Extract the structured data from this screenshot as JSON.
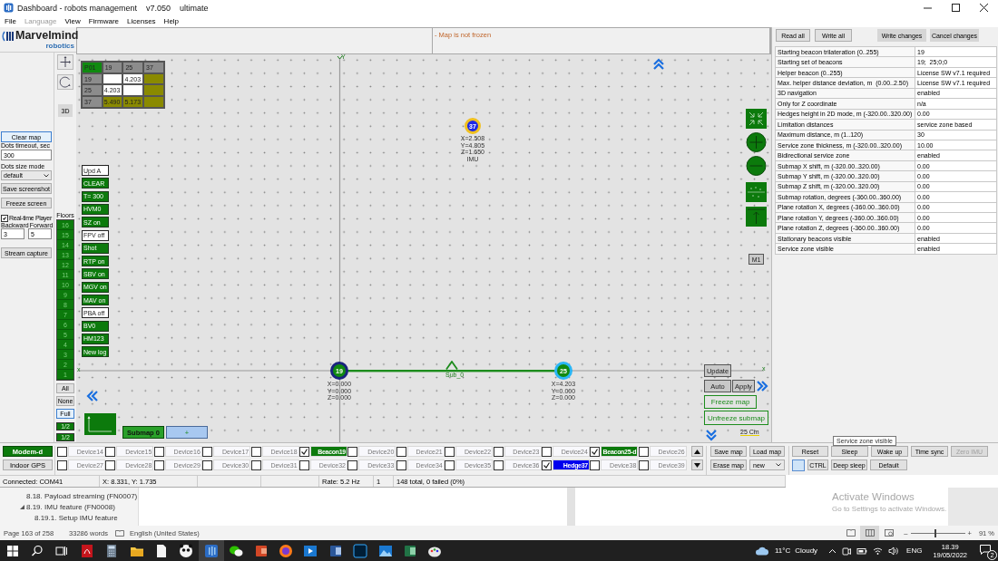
{
  "window": {
    "title": "Dashboard - robots management",
    "version": "v7.050",
    "edition": "ultimate"
  },
  "menu": [
    {
      "label": "File",
      "disabled": false
    },
    {
      "label": "Language",
      "disabled": true
    },
    {
      "label": "View",
      "disabled": false
    },
    {
      "label": "Firmware",
      "disabled": false
    },
    {
      "label": "Licenses",
      "disabled": false
    },
    {
      "label": "Help",
      "disabled": false
    }
  ],
  "logo": {
    "name": "Marvelmind",
    "tagline": "robotics"
  },
  "left_panel": {
    "clear_map": "Clear map",
    "dots_timeout": {
      "label": "Dots timeout, sec",
      "value": "300"
    },
    "dots_size": {
      "label": "Dots size mode",
      "value": "default"
    },
    "save_screenshot": "Save screenshot",
    "freeze_screen": "Freeze screen",
    "realtime_player": {
      "label": "Real-time Player",
      "checked": true
    },
    "backward": {
      "label": "Backward",
      "value": "3"
    },
    "forward": {
      "label": "Forward",
      "value": "5"
    },
    "stream_capture": "Stream capture"
  },
  "tools": {
    "view_3d": "3D"
  },
  "floors": {
    "label": "Floors",
    "items": [
      "16",
      "15",
      "14",
      "13",
      "12",
      "11",
      "10",
      "9",
      "8",
      "7",
      "6",
      "5",
      "4",
      "3",
      "2",
      "1"
    ],
    "filters": [
      {
        "label": "All",
        "selected": false
      },
      {
        "label": "None",
        "selected": false
      },
      {
        "label": "Full",
        "selected": true
      }
    ],
    "scales": [
      "1/2",
      "1/2"
    ]
  },
  "map_header": {
    "status": "- Map is not frozen"
  },
  "distance_table": {
    "corner": "P01",
    "columns": [
      {
        "id": "19",
        "kind": "beacon"
      },
      {
        "id": "25",
        "kind": "beacon"
      },
      {
        "id": "37",
        "kind": "hedge"
      }
    ],
    "rows": [
      {
        "id": "19",
        "kind": "beacon",
        "cells": [
          null,
          "4.203",
          null
        ]
      },
      {
        "id": "25",
        "kind": "beacon",
        "cells": [
          "4.203",
          null,
          null
        ]
      },
      {
        "id": "37",
        "kind": "hedge",
        "cells": [
          "5.490",
          "5.173",
          null
        ]
      }
    ]
  },
  "map_toggles": [
    {
      "label": "Upd A",
      "on": false
    },
    {
      "label": "CLEAR",
      "on": true
    },
    {
      "label": "T= 300",
      "on": true
    },
    {
      "label": "HVM0",
      "on": true
    },
    {
      "label": "SZ on",
      "on": true
    },
    {
      "label": "FPV off",
      "on": false
    },
    {
      "label": "Shot",
      "on": true
    },
    {
      "label": "RTP on",
      "on": true
    },
    {
      "label": "SBV on",
      "on": true
    },
    {
      "label": "MGV on",
      "on": true
    },
    {
      "label": "MAV on",
      "on": true
    },
    {
      "label": "PBA off",
      "on": false
    },
    {
      "label": "BV0",
      "on": true
    },
    {
      "label": "HM123",
      "on": true
    },
    {
      "label": "New log",
      "on": true
    }
  ],
  "map": {
    "axis_labels": {
      "y": "Y",
      "x_left": "x",
      "x_right": "x"
    },
    "nodes": [
      {
        "id": "37",
        "kind": "hedge",
        "color": "#f0c020",
        "coords": "X=2.508\nY=4.805\nZ=1.650",
        "note": "IMU"
      },
      {
        "id": "19",
        "kind": "beacon",
        "color": "#1a237e",
        "coords": "X=0.000\nY=0.000\nZ=0.000"
      },
      {
        "id": "25",
        "kind": "beacon",
        "color": "#29b6f6",
        "coords": "X=4.203\nY=0.000\nZ=0.000"
      }
    ],
    "submap_marker": "Sub_0",
    "scale": "25 Cm",
    "marker": "M1",
    "controls": {
      "update": "Update",
      "auto": "Auto",
      "apply": "Apply",
      "freeze": "Freeze map",
      "unfreeze": "Unfreeze submap"
    },
    "submap_tabs": [
      {
        "label": "Submap 0",
        "kind": "submap"
      },
      {
        "label": "+",
        "kind": "add"
      }
    ]
  },
  "settings": {
    "buttons": [
      "Read all",
      "Write all",
      "Write changes",
      "Cancel changes"
    ],
    "rows": [
      {
        "label": "Starting beacon trilateration (0..255)",
        "value": "19"
      },
      {
        "label": "Starting set of beacons",
        "value": "19;  25;0;0"
      },
      {
        "label": "Helper beacon (0..255)",
        "value": "License SW v7.1 required"
      },
      {
        "label": "Max. helper distance deviation, m  (0.00..2.50)",
        "value": "License SW v7.1 required"
      },
      {
        "label": "3D navigation",
        "value": "enabled"
      },
      {
        "label": "Only for Z coordinate",
        "value": "n/a"
      },
      {
        "label": "Hedges height in 2D mode, m (-320.00..320.00)",
        "value": "0.00"
      },
      {
        "label": "Limitation distances",
        "value": "service zone based"
      },
      {
        "label": "Maximum distance, m (1..120)",
        "value": "30"
      },
      {
        "label": "Service zone thickness, m (-320.00..320.00)",
        "value": "10.00"
      },
      {
        "label": "Bidirectional service zone",
        "value": "enabled"
      },
      {
        "label": "Submap X shift, m (-320.00..320.00)",
        "value": "0.00"
      },
      {
        "label": "Submap Y shift, m (-320.00..320.00)",
        "value": "0.00"
      },
      {
        "label": "Submap Z shift, m (-320.00..320.00)",
        "value": "0.00"
      },
      {
        "label": "Submap rotation, degrees (-360.00..360.00)",
        "value": "0.00"
      },
      {
        "label": "Plane rotation X, degrees (-360.00..360.00)",
        "value": "0.00"
      },
      {
        "label": "Plane rotation Y, degrees (-360.00..360.00)",
        "value": "0.00"
      },
      {
        "label": "Plane rotation Z, degrees (-360.00..360.00)",
        "value": "0.00"
      },
      {
        "label": "Stationary beacons visible",
        "value": "enabled"
      },
      {
        "label": "Service zone visible",
        "value": "enabled"
      }
    ]
  },
  "tooltip": "Service zone visible",
  "devices": {
    "modes": [
      {
        "label": "Modem-d",
        "selected": true
      },
      {
        "label": "Indoor GPS",
        "selected": false
      }
    ],
    "rows": [
      [
        {
          "name": "Device14",
          "kind": "device",
          "checked": false
        },
        {
          "name": "Device15",
          "kind": "device",
          "checked": false
        },
        {
          "name": "Device16",
          "kind": "device",
          "checked": false
        },
        {
          "name": "Device17",
          "kind": "device",
          "checked": false
        },
        {
          "name": "Device18",
          "kind": "device",
          "checked": false
        },
        {
          "name": "Beacon19",
          "kind": "beacon",
          "checked": true
        },
        {
          "name": "Device20",
          "kind": "device",
          "checked": false
        },
        {
          "name": "Device21",
          "kind": "device",
          "checked": false
        },
        {
          "name": "Device22",
          "kind": "device",
          "checked": false
        },
        {
          "name": "Device23",
          "kind": "device",
          "checked": false
        },
        {
          "name": "Device24",
          "kind": "device",
          "checked": false
        },
        {
          "name": "Beacon25-d",
          "kind": "beacon",
          "checked": true
        },
        {
          "name": "Device26",
          "kind": "device",
          "checked": false
        }
      ],
      [
        {
          "name": "Device27",
          "kind": "device",
          "checked": false
        },
        {
          "name": "Device28",
          "kind": "device",
          "checked": false
        },
        {
          "name": "Device29",
          "kind": "device",
          "checked": false
        },
        {
          "name": "Device30",
          "kind": "device",
          "checked": false
        },
        {
          "name": "Device31",
          "kind": "device",
          "checked": false
        },
        {
          "name": "Device32",
          "kind": "device",
          "checked": false
        },
        {
          "name": "Device33",
          "kind": "device",
          "checked": false
        },
        {
          "name": "Device34",
          "kind": "device",
          "checked": false
        },
        {
          "name": "Device35",
          "kind": "device",
          "checked": false
        },
        {
          "name": "Device36",
          "kind": "device",
          "checked": false
        },
        {
          "name": "Hedge37",
          "kind": "hedge",
          "checked": true
        },
        {
          "name": "Device38",
          "kind": "device",
          "checked": false
        },
        {
          "name": "Device39",
          "kind": "device",
          "checked": false
        }
      ]
    ]
  },
  "map_file": {
    "save": "Save map",
    "load": "Load map",
    "erase": "Erase map",
    "choice": "new"
  },
  "device_actions": {
    "rows": [
      [
        {
          "label": "Reset",
          "disabled": false
        },
        {
          "label": "Sleep",
          "disabled": false
        },
        {
          "label": "Wake up",
          "disabled": false
        },
        {
          "label": "Time sync",
          "disabled": false
        },
        {
          "label": "Zero IMU",
          "disabled": true
        }
      ],
      [
        {
          "label": "CTRL",
          "disabled": false
        },
        {
          "label": "Deep sleep",
          "disabled": false
        },
        {
          "label": "Default",
          "disabled": false
        }
      ]
    ]
  },
  "status_bar": [
    "Connected: COM41",
    "X: 8.331, Y: 1.735",
    "Rate: 5.2 Hz",
    "1",
    "148 total, 0 failed (0%)"
  ],
  "document": {
    "outline": [
      {
        "label": "8.18. Payload streaming (FN0007)"
      },
      {
        "label": "8.19. IMU feature (FN0008)",
        "expanded": true,
        "children": [
          {
            "label": "8.19.1. Setup IMU feature"
          }
        ]
      }
    ],
    "activation": {
      "title": "Activate Windows",
      "text": "Go to Settings to activate Windows."
    }
  },
  "word_status": {
    "page": "Page 163 of 258",
    "words": "33286 words",
    "language": "English (United States)",
    "zoom_out": "–",
    "zoom_in": "+",
    "zoom": "91 %",
    "zoom_slider": {
      "level": 0.46
    }
  },
  "taskbar": {
    "apps": [
      {
        "kind": "pdf",
        "selected": false
      },
      {
        "kind": "calculator",
        "selected": false
      },
      {
        "kind": "folder",
        "selected": false
      },
      {
        "kind": "document",
        "selected": false
      },
      {
        "kind": "panda",
        "selected": false
      },
      {
        "kind": "dashboard",
        "selected": true
      },
      {
        "kind": "chat",
        "selected": false
      },
      {
        "kind": "slides",
        "selected": false
      },
      {
        "kind": "browser",
        "selected": false
      },
      {
        "kind": "video",
        "selected": false
      },
      {
        "kind": "word",
        "selected": false
      },
      {
        "kind": "photoshop",
        "selected": false
      },
      {
        "kind": "photos",
        "selected": false
      },
      {
        "kind": "spreadsheet",
        "selected": false
      },
      {
        "kind": "paint",
        "selected": false
      }
    ],
    "weather": {
      "temp": "11°C",
      "condition": "Cloudy"
    },
    "language": "ENG",
    "time": "18.39",
    "date": "19/05/2022",
    "notifications": "2"
  }
}
